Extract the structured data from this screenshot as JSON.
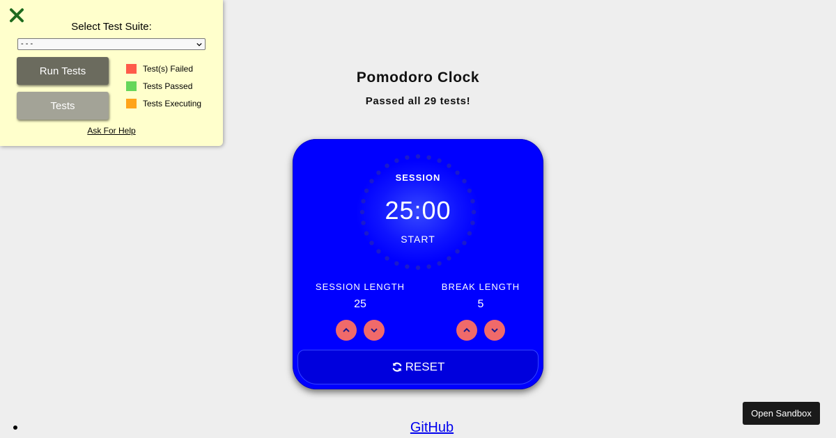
{
  "test_panel": {
    "suite_label": "Select Test Suite:",
    "suite_selected": "- - -",
    "run_label": "Run Tests",
    "tests_label": "Tests",
    "legend": [
      {
        "label": "Test(s) Failed",
        "color": "#ff5b4a"
      },
      {
        "label": "Tests Passed",
        "color": "#66d65a"
      },
      {
        "label": "Tests Executing",
        "color": "#ffa41a"
      }
    ],
    "help_label": "Ask For Help",
    "close_color": "#1e6b1e"
  },
  "page": {
    "title": "Pomodoro Clock",
    "status": "Passed all 29 tests!"
  },
  "clock": {
    "timer_label": "SESSION",
    "time_left": "25:00",
    "start_label": "START",
    "session": {
      "label": "SESSION LENGTH",
      "value": "25"
    },
    "break": {
      "label": "BREAK LENGTH",
      "value": "5"
    },
    "reset_label": "RESET",
    "card_color": "#0000ff",
    "button_color": "#f06a6a"
  },
  "footer": {
    "github_label": "GitHub",
    "sandbox_label": "Open Sandbox"
  }
}
